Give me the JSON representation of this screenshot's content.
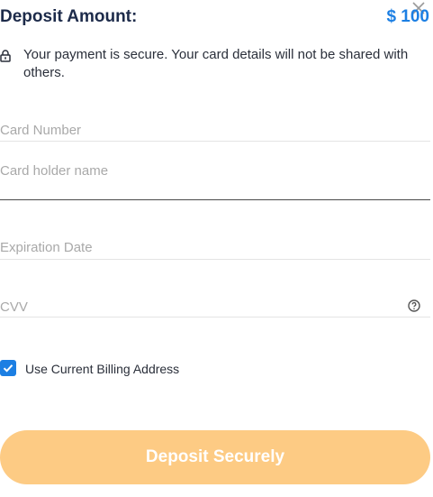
{
  "header": {
    "title": "Deposit Amount:",
    "amount": "$ 100",
    "close_icon": "close-icon"
  },
  "security": {
    "icon": "lock-icon",
    "message": "Your payment is secure. Your card details will not be shared with others."
  },
  "form": {
    "card_number": {
      "placeholder": "Card Number",
      "value": ""
    },
    "card_holder": {
      "placeholder": "Card holder name",
      "value": ""
    },
    "expiration": {
      "placeholder": "Expiration Date",
      "value": ""
    },
    "cvv": {
      "placeholder": "CVV",
      "value": "",
      "help_icon": "question-circle-icon"
    }
  },
  "billing": {
    "label": "Use Current Billing Address",
    "checked": true
  },
  "submit": {
    "label": "Deposit Securely"
  },
  "colors": {
    "accent": "#1c7fe3",
    "title": "#1d2b4a",
    "button": "#fdcb84"
  }
}
